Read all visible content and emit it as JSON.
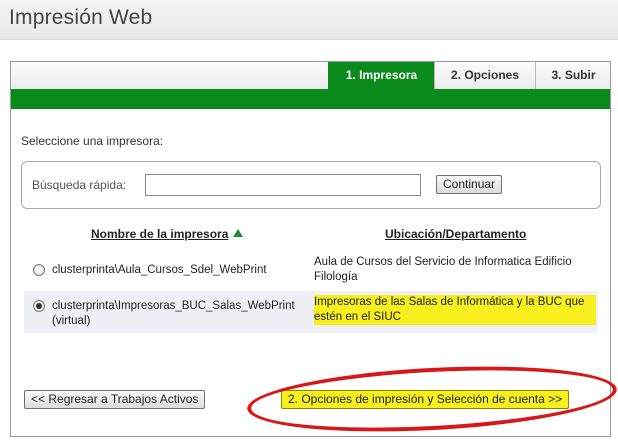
{
  "app": {
    "title": "Impresión Web"
  },
  "tabs": [
    {
      "label": "1. Impresora",
      "active": true
    },
    {
      "label": "2. Opciones",
      "active": false
    },
    {
      "label": "3. Subir",
      "active": false
    }
  ],
  "colors": {
    "accent": "#0a8a1a",
    "highlight": "#f7f01e",
    "annotation": "#d81818"
  },
  "select_label": "Seleccione una impresora:",
  "search": {
    "label": "Búsqueda rápida:",
    "value": "",
    "placeholder": "",
    "button": "Continuar"
  },
  "table": {
    "columns": [
      "Nombre de la impresora",
      "Ubicación/Departamento"
    ],
    "sort_icon": "sort-ascending-icon",
    "rows": [
      {
        "name": "clusterprinta\\Aula_Cursos_Sdel_WebPrint",
        "location": "Aula de Cursos del Servicio de Informatica Edificio Filología",
        "selected": false
      },
      {
        "name": "clusterprinta\\Impresoras_BUC_Salas_WebPrint (virtual)",
        "location": "Impresoras de las Salas de Informática y la BUC que estén en el SIUC",
        "selected": true
      }
    ]
  },
  "buttons": {
    "back": "<< Regresar a Trabajos Activos",
    "next": "2. Opciones de impresión y Selección de cuenta >>"
  }
}
